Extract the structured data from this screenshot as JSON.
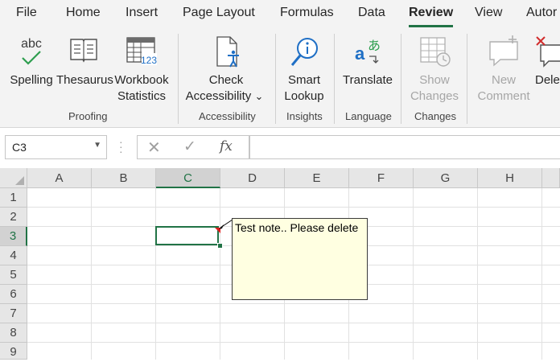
{
  "menu": {
    "tabs": [
      {
        "label": "File"
      },
      {
        "label": "Home"
      },
      {
        "label": "Insert"
      },
      {
        "label": "Page Layout"
      },
      {
        "label": "Formulas"
      },
      {
        "label": "Data"
      },
      {
        "label": "Review",
        "active": true
      },
      {
        "label": "View"
      },
      {
        "label": "Autor"
      }
    ]
  },
  "ribbon": {
    "proofing": {
      "group_label": "Proofing",
      "spelling": {
        "label": "Spelling",
        "icon_text": "abc"
      },
      "thesaurus": {
        "label": "Thesaurus"
      },
      "workbook_statistics": {
        "line1": "Workbook",
        "line2": "Statistics",
        "icon_text": "123"
      }
    },
    "accessibility": {
      "group_label": "Accessibility",
      "check": {
        "line1": "Check",
        "line2": "Accessibility",
        "caret": "⌄"
      }
    },
    "insights": {
      "group_label": "Insights",
      "smart_lookup": {
        "line1": "Smart",
        "line2": "Lookup"
      }
    },
    "language": {
      "group_label": "Language",
      "translate": {
        "label": "Translate",
        "icon_a": "a",
        "icon_b": "あ"
      }
    },
    "changes": {
      "group_label": "Changes",
      "show_changes": {
        "line1": "Show",
        "line2": "Changes",
        "disabled": true
      }
    },
    "comments": {
      "new_comment": {
        "line1": "New",
        "line2": "Comment",
        "disabled": true
      },
      "delete": {
        "label": "Dele"
      }
    }
  },
  "formula_bar": {
    "name_box": "C3",
    "cancel_symbol": "✕",
    "enter_symbol": "✓",
    "fx_label": "fx",
    "formula": ""
  },
  "sheet": {
    "columns": [
      "A",
      "B",
      "C",
      "D",
      "E",
      "F",
      "G",
      "H"
    ],
    "rows": [
      "1",
      "2",
      "3",
      "4",
      "5",
      "6",
      "7",
      "8",
      "9"
    ],
    "selected_column": "C",
    "selected_row": "3",
    "accent_color": "#217346"
  },
  "note": {
    "cell": "C3",
    "text": "Test note.. Please delete"
  }
}
